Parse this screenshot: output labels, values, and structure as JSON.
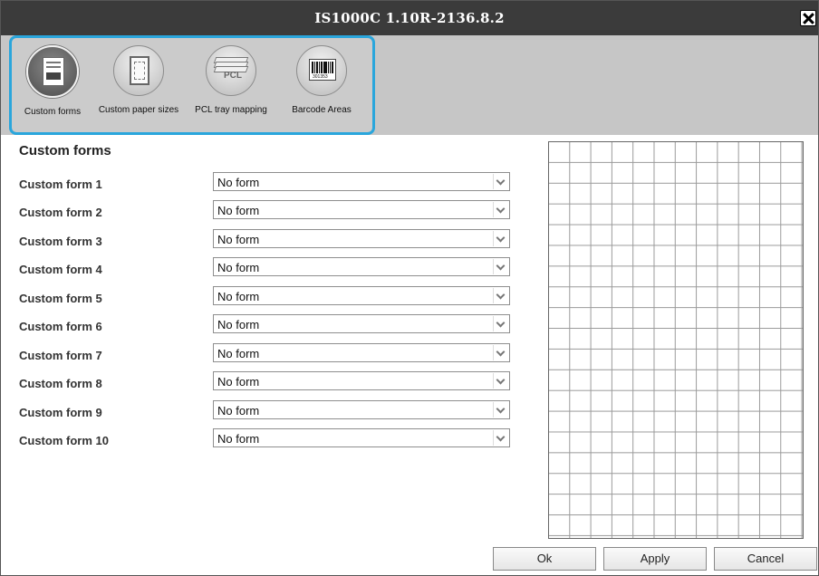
{
  "window": {
    "title": "IS1000C 1.10R-2136.8.2"
  },
  "toolbar": {
    "tools": [
      {
        "label": "Custom forms",
        "icon": "custom-forms-icon",
        "active": true
      },
      {
        "label": "Custom paper sizes",
        "icon": "custom-paper-sizes-icon",
        "active": false
      },
      {
        "label": "PCL tray mapping",
        "icon": "pcl-tray-mapping-icon",
        "active": false
      },
      {
        "label": "Barcode Areas",
        "icon": "barcode-areas-icon",
        "active": false
      }
    ],
    "pcl_icon_text": "PCL",
    "barcode_icon_digits": "301353"
  },
  "main": {
    "section_title": "Custom forms",
    "forms": [
      {
        "label": "Custom form 1",
        "value": "No form"
      },
      {
        "label": "Custom form 2",
        "value": "No form"
      },
      {
        "label": "Custom form 3",
        "value": "No form"
      },
      {
        "label": "Custom form 4",
        "value": "No form"
      },
      {
        "label": "Custom form 5",
        "value": "No form"
      },
      {
        "label": "Custom form 6",
        "value": "No form"
      },
      {
        "label": "Custom form 7",
        "value": "No form"
      },
      {
        "label": "Custom form 8",
        "value": "No form"
      },
      {
        "label": "Custom form 9",
        "value": "No form"
      },
      {
        "label": "Custom form 10",
        "value": "No form"
      }
    ]
  },
  "buttons": {
    "ok": "Ok",
    "apply": "Apply",
    "cancel": "Cancel"
  },
  "colors": {
    "titlebar": "#3b3b3b",
    "toolbar": "#c6c6c6",
    "selection_border": "#2aa6dc"
  }
}
